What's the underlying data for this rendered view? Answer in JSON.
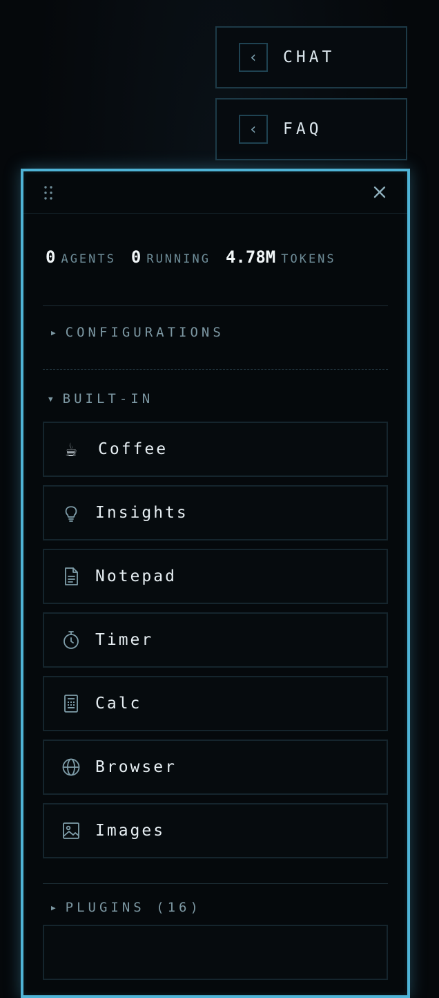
{
  "side_tabs": {
    "chat": {
      "label": "CHAT",
      "icon": "chevron-left-icon"
    },
    "faq": {
      "label": "FAQ",
      "icon": "chevron-left-icon"
    }
  },
  "panel": {
    "header": {
      "grip_icon": "drag-handle-icon",
      "close_icon": "close-icon"
    },
    "stats": [
      {
        "value": "0",
        "label": "AGENTS"
      },
      {
        "value": "0",
        "label": "RUNNING"
      },
      {
        "value": "4.78M",
        "label": "TOKENS"
      }
    ],
    "configurations": {
      "label": "CONFIGURATIONS",
      "expanded": false
    },
    "built_in": {
      "label": "BUILT-IN",
      "expanded": true,
      "tools": [
        {
          "label": "Coffee",
          "icon": "coffee-icon",
          "glyph": "☕"
        },
        {
          "label": "Insights",
          "icon": "lightbulb-icon"
        },
        {
          "label": "Notepad",
          "icon": "document-icon"
        },
        {
          "label": "Timer",
          "icon": "stopwatch-icon"
        },
        {
          "label": "Calc",
          "icon": "calculator-icon"
        },
        {
          "label": "Browser",
          "icon": "globe-icon"
        },
        {
          "label": "Images",
          "icon": "image-icon"
        }
      ]
    },
    "plugins": {
      "label": "PLUGINS (16)",
      "expanded": false
    }
  },
  "colors": {
    "accent": "#4fb3d6",
    "background": "#05080b",
    "muted_text": "#6f8d99"
  }
}
